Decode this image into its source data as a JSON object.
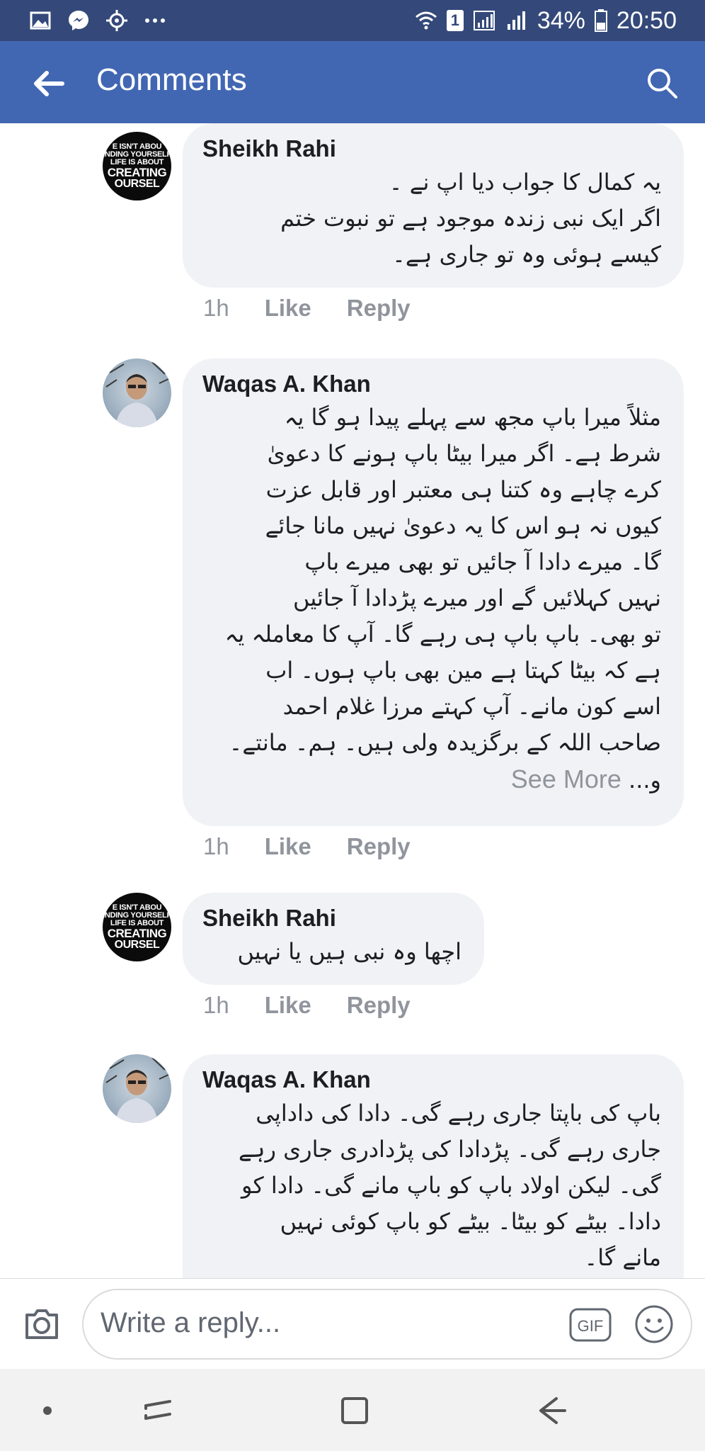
{
  "status_bar": {
    "notification_icons": [
      "image-icon",
      "messenger-icon",
      "gear-icon",
      "more-dots-icon"
    ],
    "battery": "34%",
    "time": "20:50",
    "sim_badge": "1"
  },
  "app_bar": {
    "title": "Comments"
  },
  "comments": [
    {
      "author": "Sheikh Rahi",
      "avatar_text": [
        "E ISN'T ABOU",
        "INDING YOURSELF",
        "LIFE IS ABOUT",
        "CREATING",
        "OURSEL"
      ],
      "lines": [
        "یہ کمال کا جواب دیا اپ نے ۔",
        "اگر ایک نبی زندہ موجود ہے تو نبوت ختم",
        "کیسے ہوئی وہ تو جاری ہے۔"
      ],
      "time": "1h",
      "like": "Like",
      "reply": "Reply"
    },
    {
      "author": "Waqas A. Khan",
      "lines": [
        "مثلاً میرا باپ مجھ سے پہلے پیدا ہو گا یہ",
        "شرط ہے۔ اگر میرا بیٹا باپ ہونے کا دعویٰ",
        "کرے چاہے وہ کتنا ہی معتبر اور قابل عزت",
        "کیوں نہ ہو اس کا یہ دعویٰ نہیں مانا جائے",
        "گا۔ میرے دادا آ جائیں تو بھی میرے باپ",
        "نہیں کہلائیں گے اور میرے پڑدادا آ جائیں",
        "تو بھی۔ باپ باپ ہی رہے گا۔ آپ کا معاملہ یہ",
        "ہے کہ بیٹا کہتا ہے مین بھی باپ ہوں۔ اب",
        "اسے کون مانے۔ آپ کہتے مرزا غلام احمد",
        "صاحب اللہ کے برگزیدہ ولی ہیں۔ ہم۔ مانتے۔"
      ],
      "last_line": "و...",
      "see_more": "See More",
      "time": "1h",
      "like": "Like",
      "reply": "Reply"
    },
    {
      "author": "Sheikh Rahi",
      "avatar_text": [
        "E ISN'T ABOU",
        "INDING YOURSELF",
        "LIFE IS ABOUT",
        "CREATING",
        "OURSEL"
      ],
      "lines": [
        "اچھا وہ نبی ہیں یا نہیں"
      ],
      "time": "1h",
      "like": "Like",
      "reply": "Reply"
    },
    {
      "author": "Waqas A. Khan",
      "lines": [
        "باپ کی باپتا جاری رہے گی۔ دادا کی داداپی",
        "جاری رہے گی۔ پڑدادا کی پڑدادری جاری رہے",
        "گی۔ لیکن اولاد باپ کو باپ مانے گی۔ دادا کو",
        "دادا۔ بیٹے کو بیٹا۔ بیٹے کو باپ کوئی نہیں",
        "مانے گا۔"
      ]
    }
  ],
  "reply_bar": {
    "placeholder": "Write a reply...",
    "gif_label": "GIF"
  }
}
